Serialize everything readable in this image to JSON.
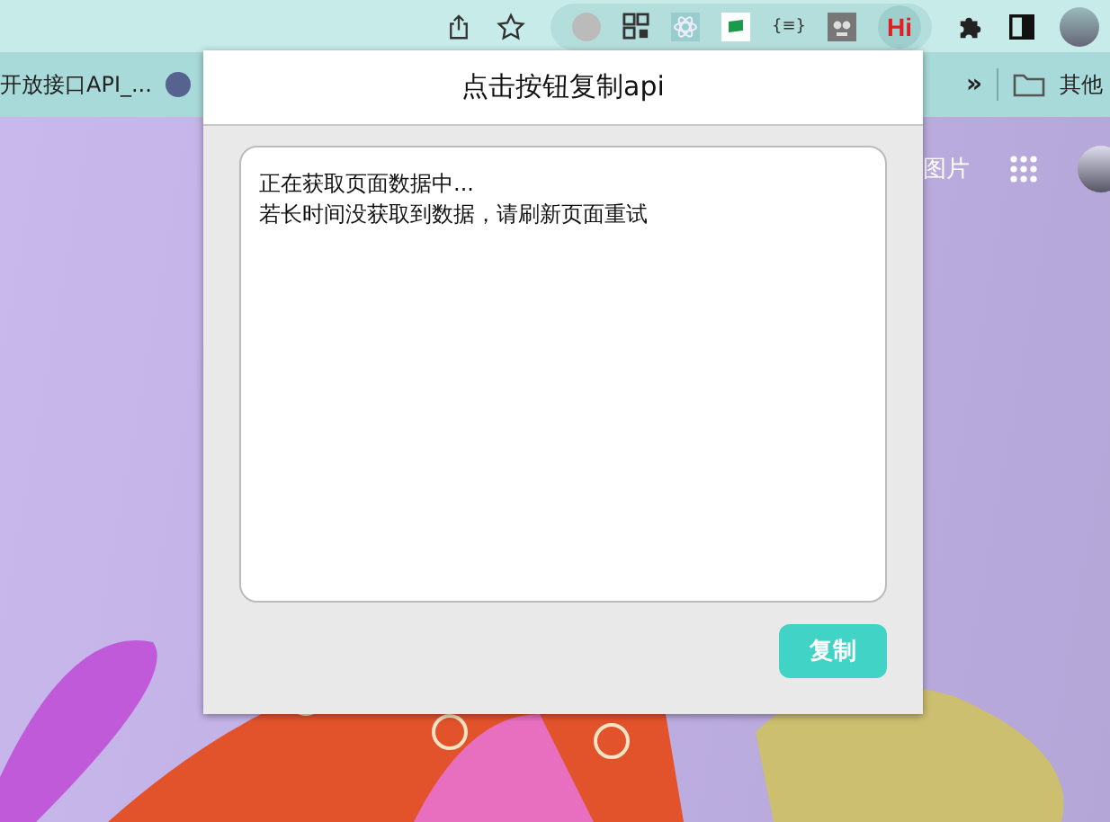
{
  "toolbar": {
    "extension_texts": [
      "{≡}",
      "Hi"
    ]
  },
  "bookmarks_bar": {
    "items": [
      "开放接口API_..."
    ],
    "overflow": "»",
    "folder": "其他"
  },
  "page": {
    "nav_link": "图片"
  },
  "popup": {
    "title": "点击按钮复制api",
    "output_lines": [
      "正在获取页面数据中...",
      "若长时间没获取到数据，请刷新页面重试"
    ],
    "copy_button": "复制"
  }
}
